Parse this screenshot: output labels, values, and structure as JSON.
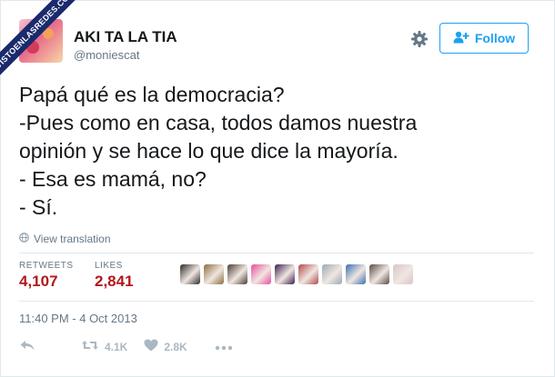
{
  "watermark": {
    "text": "VISTOENLASREDES.COM"
  },
  "user": {
    "display_name": "AKI TA LA TIA",
    "handle": "@moniescat"
  },
  "follow_button": {
    "label": "Follow"
  },
  "tweet": {
    "lines": [
      "Papá qué es la democracia?",
      "-Pues como en casa, todos damos nuestra",
      "opinión y se hace lo que dice la mayoría.",
      "- Esa es mamá, no?",
      "- Sí."
    ]
  },
  "translation": {
    "label": "View translation"
  },
  "stats": {
    "retweets_label": "RETWEETS",
    "retweets_value": "4,107",
    "likes_label": "LIKES",
    "likes_value": "2,841"
  },
  "likers": [
    {
      "name": "liker-1",
      "color": "#2b2b2b"
    },
    {
      "name": "liker-2",
      "color": "#8a6d3b"
    },
    {
      "name": "liker-3",
      "color": "#4a3b36"
    },
    {
      "name": "liker-4",
      "color": "#e84d9c"
    },
    {
      "name": "liker-5",
      "color": "#3a1f4f"
    },
    {
      "name": "liker-6",
      "color": "#b04a4a"
    },
    {
      "name": "liker-7",
      "color": "#9aa9b5"
    },
    {
      "name": "liker-8",
      "color": "#3c6fb0"
    },
    {
      "name": "liker-9",
      "color": "#5a4a45"
    },
    {
      "name": "liker-10",
      "color": "#d9c6c6"
    }
  ],
  "timestamp": "11:40 PM - 4 Oct 2013",
  "actions": {
    "retweet_count": "4.1K",
    "like_count": "2.8K"
  },
  "colors": {
    "accent": "#1da1f2",
    "retweet_value": "#b3181b",
    "likes_value": "#b3181b"
  },
  "icons": [
    "settings-gear-icon",
    "follow-person-plus-icon",
    "globe-icon",
    "reply-icon",
    "retweet-icon",
    "heart-icon",
    "more-dots-icon"
  ]
}
